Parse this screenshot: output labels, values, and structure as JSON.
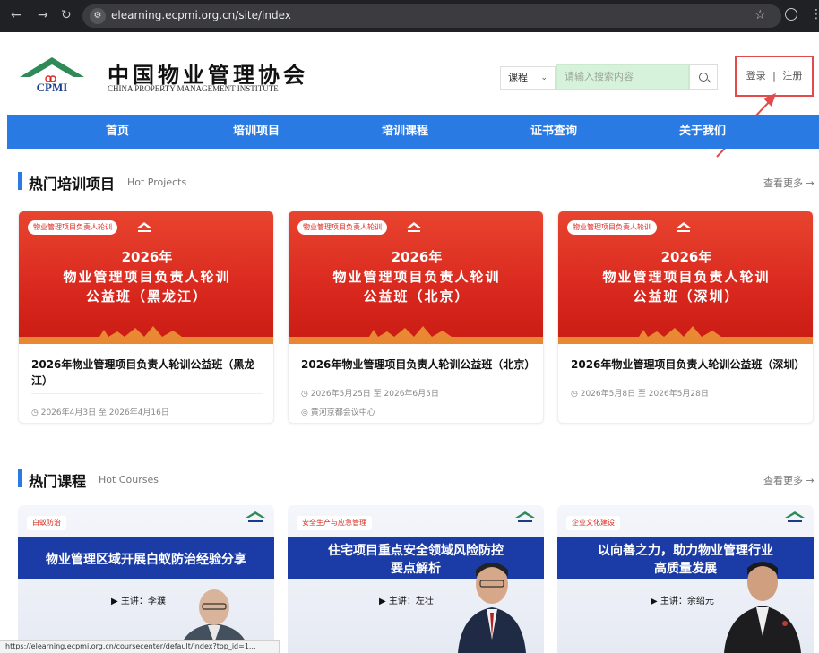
{
  "browser": {
    "url": "elearning.ecpmi.org.cn/site/index",
    "status_url": "https://elearning.ecpmi.org.cn/coursecenter/default/index?top_id=1..."
  },
  "header": {
    "logo_mark_text": "CPMI",
    "logo_cn": "中国物业管理协会",
    "logo_en": "CHINA PROPERTY MANAGEMENT INSTITUTE",
    "search_category": "课程",
    "search_placeholder": "请输入搜索内容",
    "login": "登录",
    "separator": "|",
    "register": "注册",
    "highlight_color": "#e24b4b"
  },
  "nav": {
    "color": "#2a7ae4",
    "items": [
      "首页",
      "培训项目",
      "培训课程",
      "证书查询",
      "关于我们"
    ]
  },
  "hot_projects": {
    "title": "热门培训项目",
    "subtitle": "Hot Projects",
    "more": "查看更多 →",
    "cards": [
      {
        "tag": "物业管理项目负责人轮训",
        "banner_year": "2026年",
        "banner_line2": "物业管理项目负责人轮训",
        "banner_line3": "公益班（黑龙江）",
        "title": "2026年物业管理项目负责人轮训公益班（黑龙江）",
        "date": "2026年4月3日 至 2026年4月16日",
        "location": ""
      },
      {
        "tag": "物业管理项目负责人轮训",
        "banner_year": "2026年",
        "banner_line2": "物业管理项目负责人轮训",
        "banner_line3": "公益班（北京）",
        "title": "2026年物业管理项目负责人轮训公益班（北京）",
        "date": "2026年5月25日 至 2026年6月5日",
        "location": "黄河京都会议中心"
      },
      {
        "tag": "物业管理项目负责人轮训",
        "banner_year": "2026年",
        "banner_line2": "物业管理项目负责人轮训",
        "banner_line3": "公益班（深圳）",
        "title": "2026年物业管理项目负责人轮训公益班（深圳）",
        "date": "2026年5月8日 至 2026年5月28日",
        "location": ""
      }
    ]
  },
  "hot_courses": {
    "title": "热门课程",
    "subtitle": "Hot Courses",
    "more": "查看更多 →",
    "cards": [
      {
        "tag": "白蚁防治",
        "line1": "物业管理区域开展白蚁防治经验分享",
        "line2": "",
        "lecturer": "▶ 主讲：李濮"
      },
      {
        "tag": "安全生产与应急管理",
        "line1": "住宅项目重点安全领域风险防控",
        "line2": "要点解析",
        "lecturer": "▶ 主讲：左壮"
      },
      {
        "tag": "企业文化建设",
        "line1": "以向善之力，助力物业管理行业",
        "line2": "高质量发展",
        "lecturer": "▶ 主讲：余绍元"
      }
    ]
  }
}
